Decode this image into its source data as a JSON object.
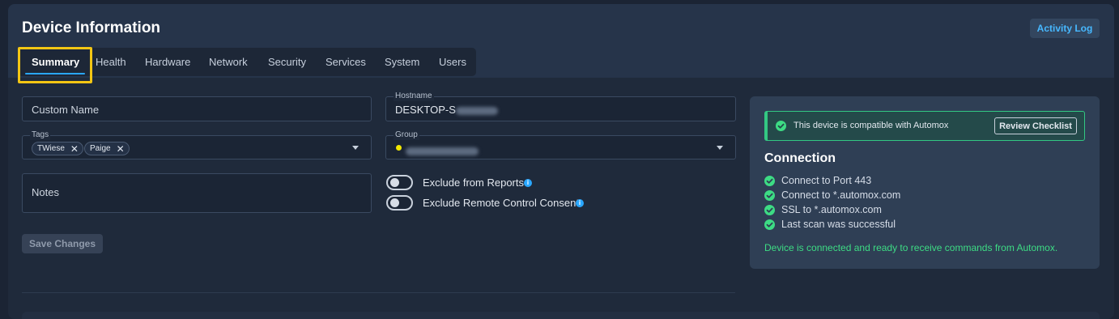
{
  "page": {
    "title": "Device Information",
    "activity_log_label": "Activity Log"
  },
  "tabs": [
    {
      "label": "Summary",
      "active": true
    },
    {
      "label": "Health"
    },
    {
      "label": "Hardware"
    },
    {
      "label": "Network"
    },
    {
      "label": "Security"
    },
    {
      "label": "Services"
    },
    {
      "label": "System"
    },
    {
      "label": "Users"
    }
  ],
  "form": {
    "custom_name_placeholder": "Custom Name",
    "hostname_label": "Hostname",
    "hostname_value_prefix": "DESKTOP-S",
    "tags_label": "Tags",
    "tags": [
      "TWiese",
      "Paige"
    ],
    "group_label": "Group",
    "notes_placeholder": "Notes",
    "exclude_reports_label": "Exclude from Reports",
    "exclude_remote_label": "Exclude Remote Control Consent",
    "save_label": "Save Changes"
  },
  "connection": {
    "compat_message": "This device is compatible with Automox",
    "review_label": "Review Checklist",
    "title": "Connection",
    "checks": [
      "Connect to Port 443",
      "Connect to *.automox.com",
      "SSL to *.automox.com",
      "Last scan was successful"
    ],
    "status": "Device is connected and ready to receive commands from Automox."
  },
  "colors": {
    "accent": "#2aa7ff",
    "highlight": "#f3c614",
    "success": "#3ddc84"
  }
}
